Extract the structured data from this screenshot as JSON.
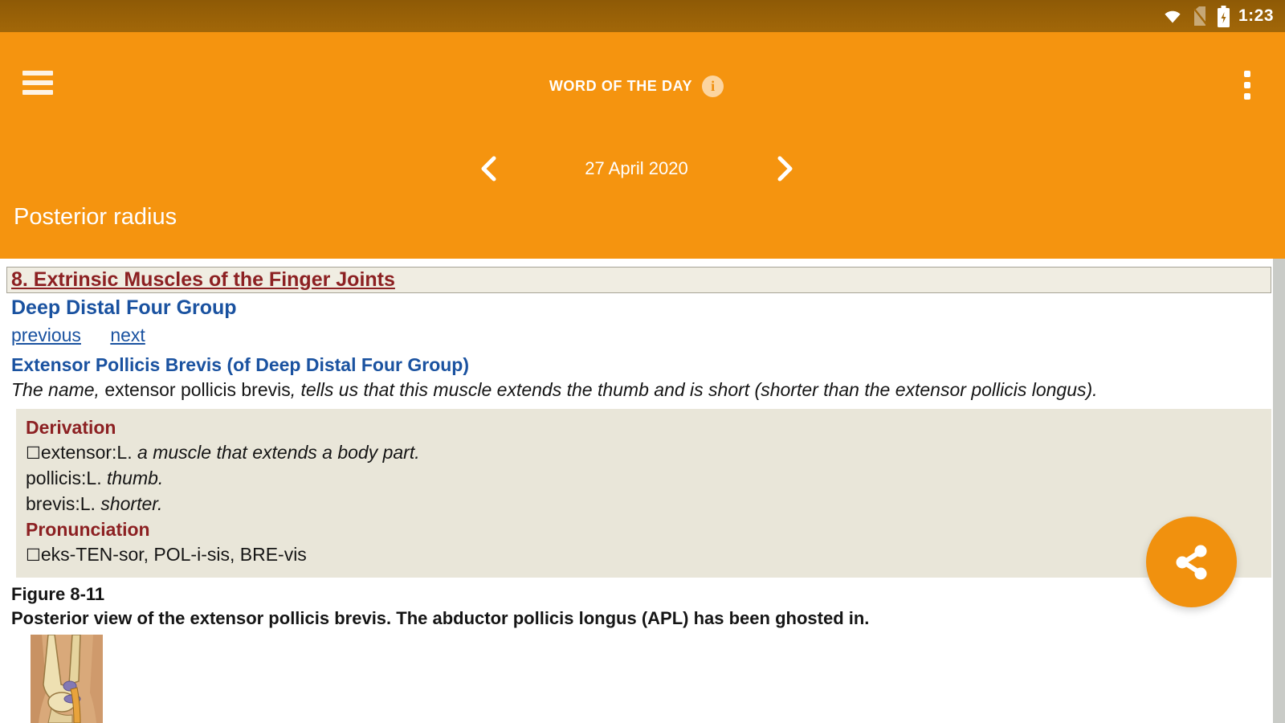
{
  "status_bar": {
    "time": "1:23",
    "icons": [
      "wifi",
      "no-sim",
      "battery-charging"
    ]
  },
  "header": {
    "title": "WORD OF THE DAY",
    "date": "27 April 2020",
    "word": "Posterior radius"
  },
  "content": {
    "section_heading": "8. Extrinsic Muscles of the Finger Joints",
    "group_heading": "Deep Distal Four Group",
    "nav": {
      "previous": "previous",
      "next": "next"
    },
    "term_heading": "Extensor Pollicis Brevis (of Deep Distal Four Group)",
    "intro": {
      "italic_1": "The name, ",
      "term": "extensor pollicis brevis",
      "italic_2": ", tells us that this muscle extends the thumb and is short (shorter than the extensor pollicis longus)."
    },
    "derivation": {
      "label": "Derivation",
      "items": [
        {
          "bullet": "☐",
          "term": "extensor:L. ",
          "meaning": "a muscle that extends a body part."
        },
        {
          "bullet": "",
          "term": "pollicis:L. ",
          "meaning": "thumb."
        },
        {
          "bullet": "",
          "term": "brevis:L. ",
          "meaning": "shorter."
        }
      ],
      "pronunciation_label": "Pronunciation",
      "pronunciation_bullet": "☐",
      "pronunciation": "eks-TEN-sor, POL-i-sis, BRE-vis"
    },
    "figure": {
      "label": "Figure 8-11",
      "caption": "Posterior view of the extensor pollicis brevis. The abductor pollicis longus (APL) has been ghosted in."
    }
  },
  "colors": {
    "status_bar": "#985f07",
    "app_bar": "#f5940f",
    "fab": "#f1910e",
    "heading_red": "#8c2022",
    "link_blue": "#1a52a0",
    "box_beige": "#e9e6d9"
  }
}
